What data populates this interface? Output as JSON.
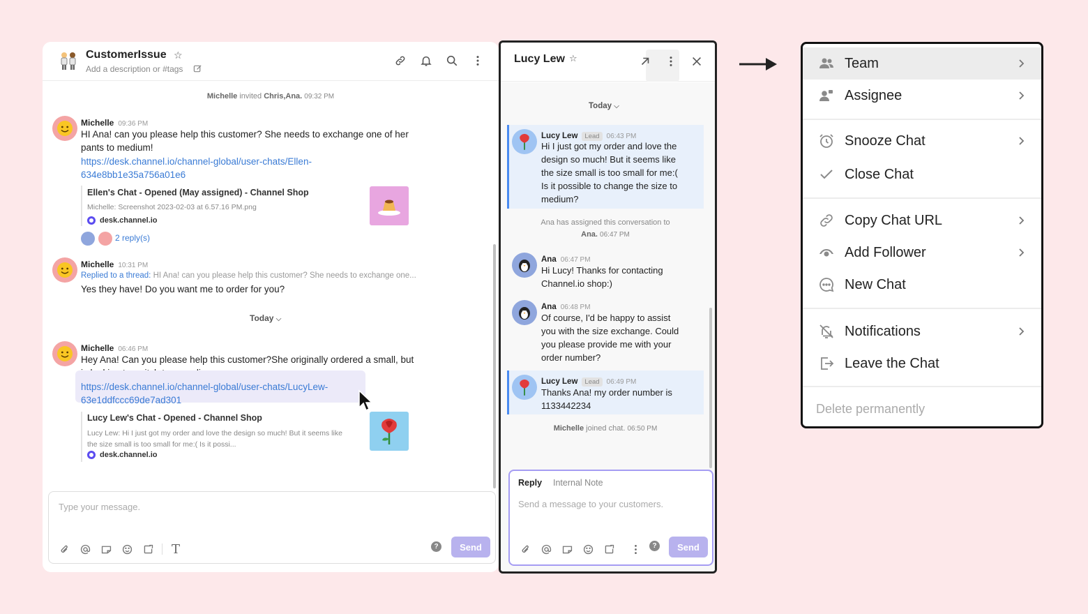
{
  "main": {
    "title": "CustomerIssue",
    "description_placeholder": "Add a description or #tags",
    "system_invite": {
      "actor": "Michelle",
      "verb": "invited",
      "targets": "Chris,Ana.",
      "time": "09:32 PM"
    },
    "messages": [
      {
        "author": "Michelle",
        "time": "09:36 PM",
        "text_line1": "HI Ana! can you please help this customer? She needs to exchange one of her",
        "text_line2": "pants to medium!",
        "link_line1": "https://desk.channel.io/channel-global/user-chats/Ellen-",
        "link_line2": "634e8bb1e35a756a01e6",
        "card": {
          "title": "Ellen's Chat - Opened (May assigned) - Channel Shop",
          "subtitle": "Michelle: Screenshot 2023-02-03 at 6.57.16 PM.png",
          "domain": "desk.channel.io"
        },
        "replies": "2 reply(s)"
      },
      {
        "author": "Michelle",
        "time": "10:31 PM",
        "thread_prefix": "Replied to a thread:",
        "thread_quote": "HI Ana! can you please help this customer? She needs to exchange one...",
        "text": "Yes they have! Do you want me to order for you?"
      },
      {
        "author": "Michelle",
        "time": "06:46 PM",
        "text_line1": "Hey Ana! Can you please help this customer?She originally ordered a small, but",
        "text_line2": "is looking to switch to a medium",
        "link_line1": "https://desk.channel.io/channel-global/user-chats/LucyLew-",
        "link_line2": "63e1ddfccc69de7ad301",
        "card": {
          "title": "Lucy Lew's Chat - Opened - Channel Shop",
          "subtitle_line1": "Lucy Lew: Hi I just got my order and love the design so much! But it seems like",
          "subtitle_line2": "the size small is too small for me:( Is it possi...",
          "domain": "desk.channel.io"
        }
      }
    ],
    "today_label": "Today",
    "composer_placeholder": "Type your message.",
    "send_label": "Send",
    "help_label": "?"
  },
  "side": {
    "title": "Lucy Lew",
    "today_label": "Today",
    "messages": [
      {
        "author": "Lucy Lew",
        "tag": "Lead",
        "time": "06:43 PM",
        "lines": [
          "Hi I just got my order and love the",
          "design so much! But it seems like",
          "the size small is too small for me:(",
          "Is it possible to change the size to",
          "medium?"
        ]
      },
      {
        "system_line1": "Ana has assigned this conversation to",
        "system_line2_name": "Ana.",
        "system_time": "06:47 PM"
      },
      {
        "author": "Ana",
        "time": "06:47 PM",
        "lines": [
          "Hi Lucy! Thanks for contacting",
          "Channel.io shop:)"
        ]
      },
      {
        "author": "Ana",
        "time": "06:48 PM",
        "lines": [
          "Of course, I'd be happy to assist",
          "you with the size exchange. Could",
          "you please provide me with your",
          "order number?"
        ]
      },
      {
        "author": "Lucy Lew",
        "tag": "Lead",
        "time": "06:49 PM",
        "lines": [
          "Thanks Ana! my order number is",
          "1133442234"
        ]
      },
      {
        "system_joined_name": "Michelle",
        "system_joined_text": "joined chat.",
        "system_joined_time": "06:50 PM"
      }
    ],
    "reply_tab": "Reply",
    "note_tab": "Internal Note",
    "composer_placeholder": "Send a message to your customers.",
    "send_label": "Send",
    "help_label": "?"
  },
  "menu": {
    "items": [
      {
        "label": "Team",
        "icon": "team-icon",
        "chevron": true
      },
      {
        "label": "Assignee",
        "icon": "assignee-icon",
        "chevron": true
      },
      {
        "label": "Snooze Chat",
        "icon": "alarm-clock-icon",
        "chevron": true
      },
      {
        "label": "Close Chat",
        "icon": "checkmark-icon",
        "chevron": false
      },
      {
        "label": "Copy Chat URL",
        "icon": "link-icon",
        "chevron": true
      },
      {
        "label": "Add Follower",
        "icon": "eye-icon",
        "chevron": true
      },
      {
        "label": "New Chat",
        "icon": "chat-bubble-icon",
        "chevron": false
      },
      {
        "label": "Notifications",
        "icon": "bell-off-icon",
        "chevron": true
      },
      {
        "label": "Leave the Chat",
        "icon": "exit-icon",
        "chevron": false
      }
    ],
    "delete_label": "Delete permanently"
  },
  "colors": {
    "background": "#fde8ea",
    "link": "#3a7bd5",
    "send_button": "#b8b2ee",
    "lead_highlight": "#e8f0fb",
    "reply_border": "#a59cf3"
  }
}
